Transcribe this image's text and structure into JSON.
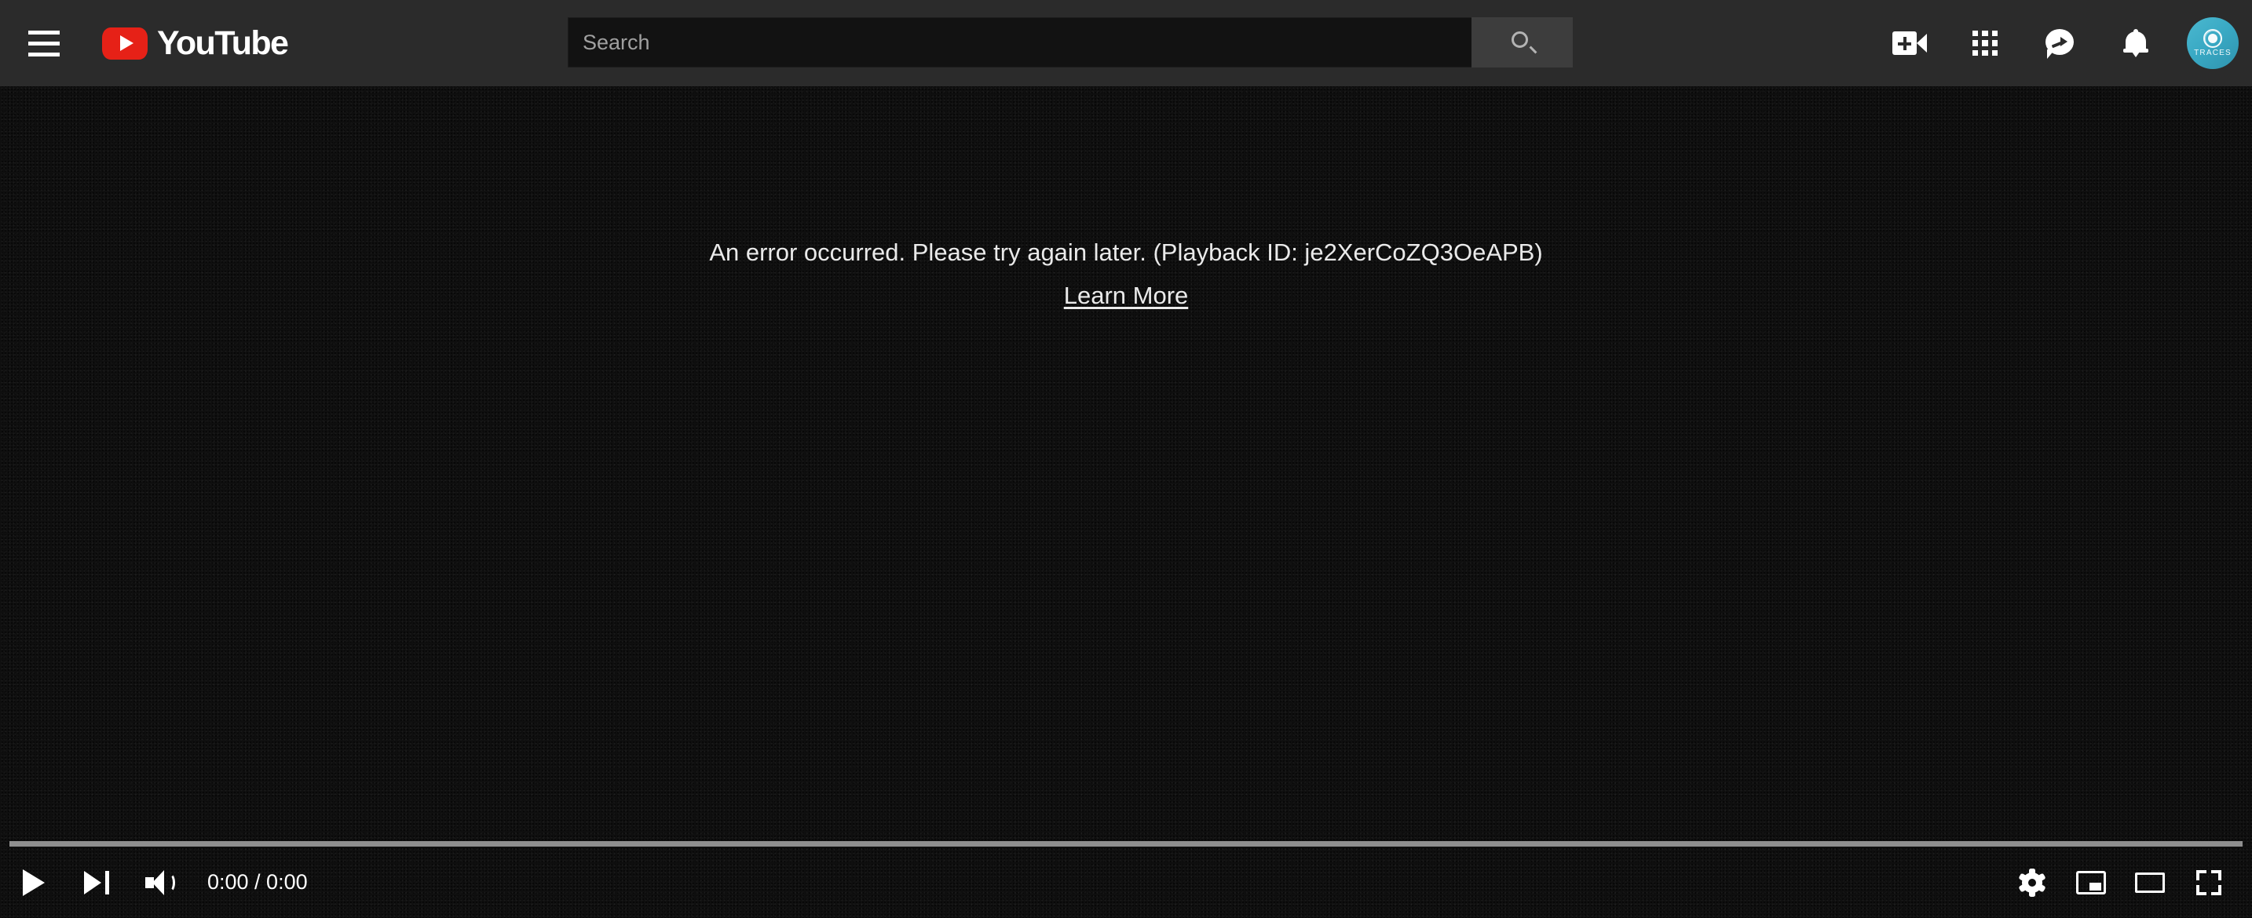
{
  "header": {
    "guide_label": "Guide",
    "logo_text": "YouTube",
    "search": {
      "placeholder": "Search",
      "value": "",
      "submit_label": "Search",
      "icon": "magnifier-icon"
    },
    "buttons": [
      {
        "name": "create-video",
        "icon": "video-camera-plus-icon",
        "label": "Create a video or post"
      },
      {
        "name": "apps",
        "icon": "apps-grid-icon",
        "label": "YouTube apps"
      },
      {
        "name": "messages",
        "icon": "message-share-icon",
        "label": "Messages"
      },
      {
        "name": "notifications",
        "icon": "bell-icon",
        "label": "Notifications"
      }
    ],
    "avatar": {
      "brand": "TRACES",
      "color": "#3ba9c2",
      "label": "Account"
    }
  },
  "player": {
    "error": {
      "message": "An error occurred. Please try again later. (Playback ID: je2XerCoZQ3OeAPB)",
      "playback_id": "je2XerCoZQ3OeAPB",
      "learn_more_label": "Learn More"
    },
    "background_color": "#101010",
    "progress": {
      "percent": 0,
      "accent": "#ff0000",
      "track": "#8f8f8f"
    },
    "controls": {
      "play_label": "Play",
      "next_label": "Next",
      "volume_label": "Mute",
      "time": "0:00 / 0:00",
      "current_time": "0:00",
      "duration": "0:00",
      "settings_label": "Settings",
      "miniplayer_label": "Miniplayer",
      "theater_label": "Theater mode",
      "fullscreen_label": "Full screen"
    }
  },
  "colors": {
    "masthead": "#2b2b2b",
    "search_field": "#121212",
    "search_button": "#3d3d3d",
    "brand_red": "#e62117",
    "text": "#eaeaea"
  }
}
